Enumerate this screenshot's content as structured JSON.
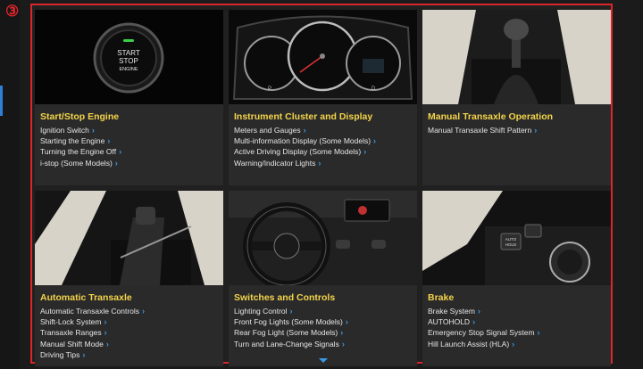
{
  "badge": "③",
  "sections": [
    {
      "title": "Start/Stop Engine",
      "button_text": [
        "START",
        "STOP",
        "ENGINE"
      ],
      "links": [
        "Ignition Switch",
        "Starting the Engine",
        "Turning the Engine Off",
        "i-stop (Some Models)"
      ]
    },
    {
      "title": "Instrument Cluster and Display",
      "gauge_labels": [
        "P",
        "D"
      ],
      "links": [
        "Meters and Gauges",
        "Multi-information Display (Some Models)",
        "Active Driving Display (Some Models)",
        "Warning/Indicator Lights"
      ]
    },
    {
      "title": "Manual Transaxle Operation",
      "links": [
        "Manual Transaxle Shift Pattern"
      ]
    },
    {
      "title": "Automatic Transaxle",
      "links": [
        "Automatic Transaxle Controls",
        "Shift-Lock System",
        "Transaxle Ranges",
        "Manual Shift Mode",
        "Driving Tips"
      ]
    },
    {
      "title": "Switches and Controls",
      "links": [
        "Lighting Control",
        "Front Fog Lights (Some Models)",
        "Rear Fog Light (Some Models)",
        "Turn and Lane-Change Signals"
      ]
    },
    {
      "title": "Brake",
      "button_text": [
        "AUTO",
        "HOLD"
      ],
      "links": [
        "Brake System",
        "AUTOHOLD",
        "Emergency Stop Signal System",
        "Hill Launch Assist (HLA)"
      ]
    }
  ],
  "colors": {
    "accent": "#f4d44a",
    "link_chevron": "#3a9ae8",
    "highlight_frame": "#d9262a"
  }
}
